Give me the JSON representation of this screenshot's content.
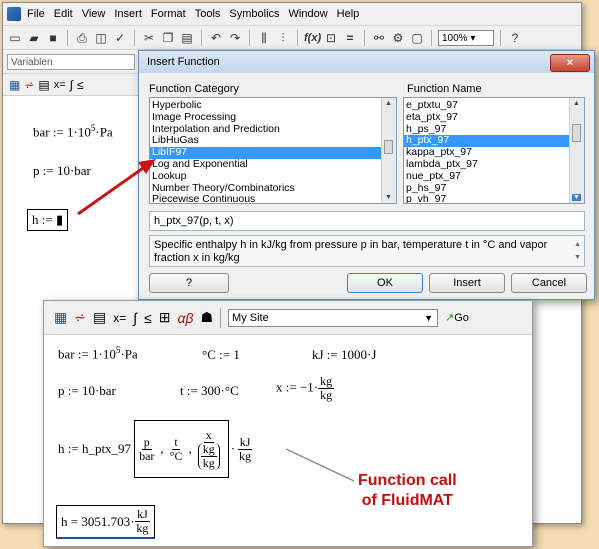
{
  "menubar": {
    "items": [
      "File",
      "Edit",
      "View",
      "Insert",
      "Format",
      "Tools",
      "Symbolics",
      "Window",
      "Help"
    ]
  },
  "toolbar": {
    "zoom": "100%"
  },
  "style_box": "Variablen",
  "worksheet": {
    "bar_def": "bar := 1·10",
    "bar_exp": "5",
    "bar_unit": "·Pa",
    "p_def": "p := 10·bar",
    "h_def": "h := ▮"
  },
  "dialog": {
    "title": "Insert Function",
    "close": "×",
    "category_label": "Function Category",
    "name_label": "Function Name",
    "categories": [
      "Hyperbolic",
      "Image Processing",
      "Interpolation and Prediction",
      "LibHuGas",
      "LibIF97",
      "Log and Exponential",
      "Lookup",
      "Number Theory/Combinatorics",
      "Piecewise Continuous"
    ],
    "selected_category": "LibIF97",
    "names": [
      "e_ptxtu_97",
      "eta_ptx_97",
      "h_ps_97",
      "h_ptx_97",
      "kappa_ptx_97",
      "lambda_ptx_97",
      "nue_ptx_97",
      "p_hs_97",
      "p_vh_97"
    ],
    "selected_name": "h_ptx_97",
    "signature": "h_ptx_97(p, t, x)",
    "description": "Specific enthalpy h in kJ/kg from pressure p in bar, temperature t in °C and vapor fraction x in kg/kg",
    "help_btn": "?",
    "ok_btn": "OK",
    "insert_btn": "Insert",
    "cancel_btn": "Cancel"
  },
  "panel": {
    "site": "My Site",
    "go": "Go",
    "line1": {
      "bar": "bar := 1·10",
      "bar_exp": "5",
      "bar_unit": "·Pa",
      "degc": "°C := 1",
      "kj": "kJ := 1000·J"
    },
    "line2": {
      "p": "p := 10·bar",
      "t": "t := 300·°C",
      "x_pre": "x := −1·",
      "x_num": "kg",
      "x_den": "kg"
    },
    "line3": {
      "h_pre": "h := h_ptx_97",
      "p_num": "p",
      "p_den": "bar",
      "t_num": "t",
      "t_den": "°C",
      "x_num": "x",
      "kg_num": "kg",
      "kg_den": "kg",
      "kj_num": "kJ",
      "kj_den": "kg"
    },
    "result": {
      "pre": "h = 3051.703·",
      "num": "kJ",
      "den": "kg"
    }
  },
  "annotation": {
    "line1": "Function call",
    "line2": "of FluidMAT"
  },
  "colors": {
    "arrow": "#c81414",
    "selection": "#3399ff",
    "background": "#f4dcb4"
  }
}
